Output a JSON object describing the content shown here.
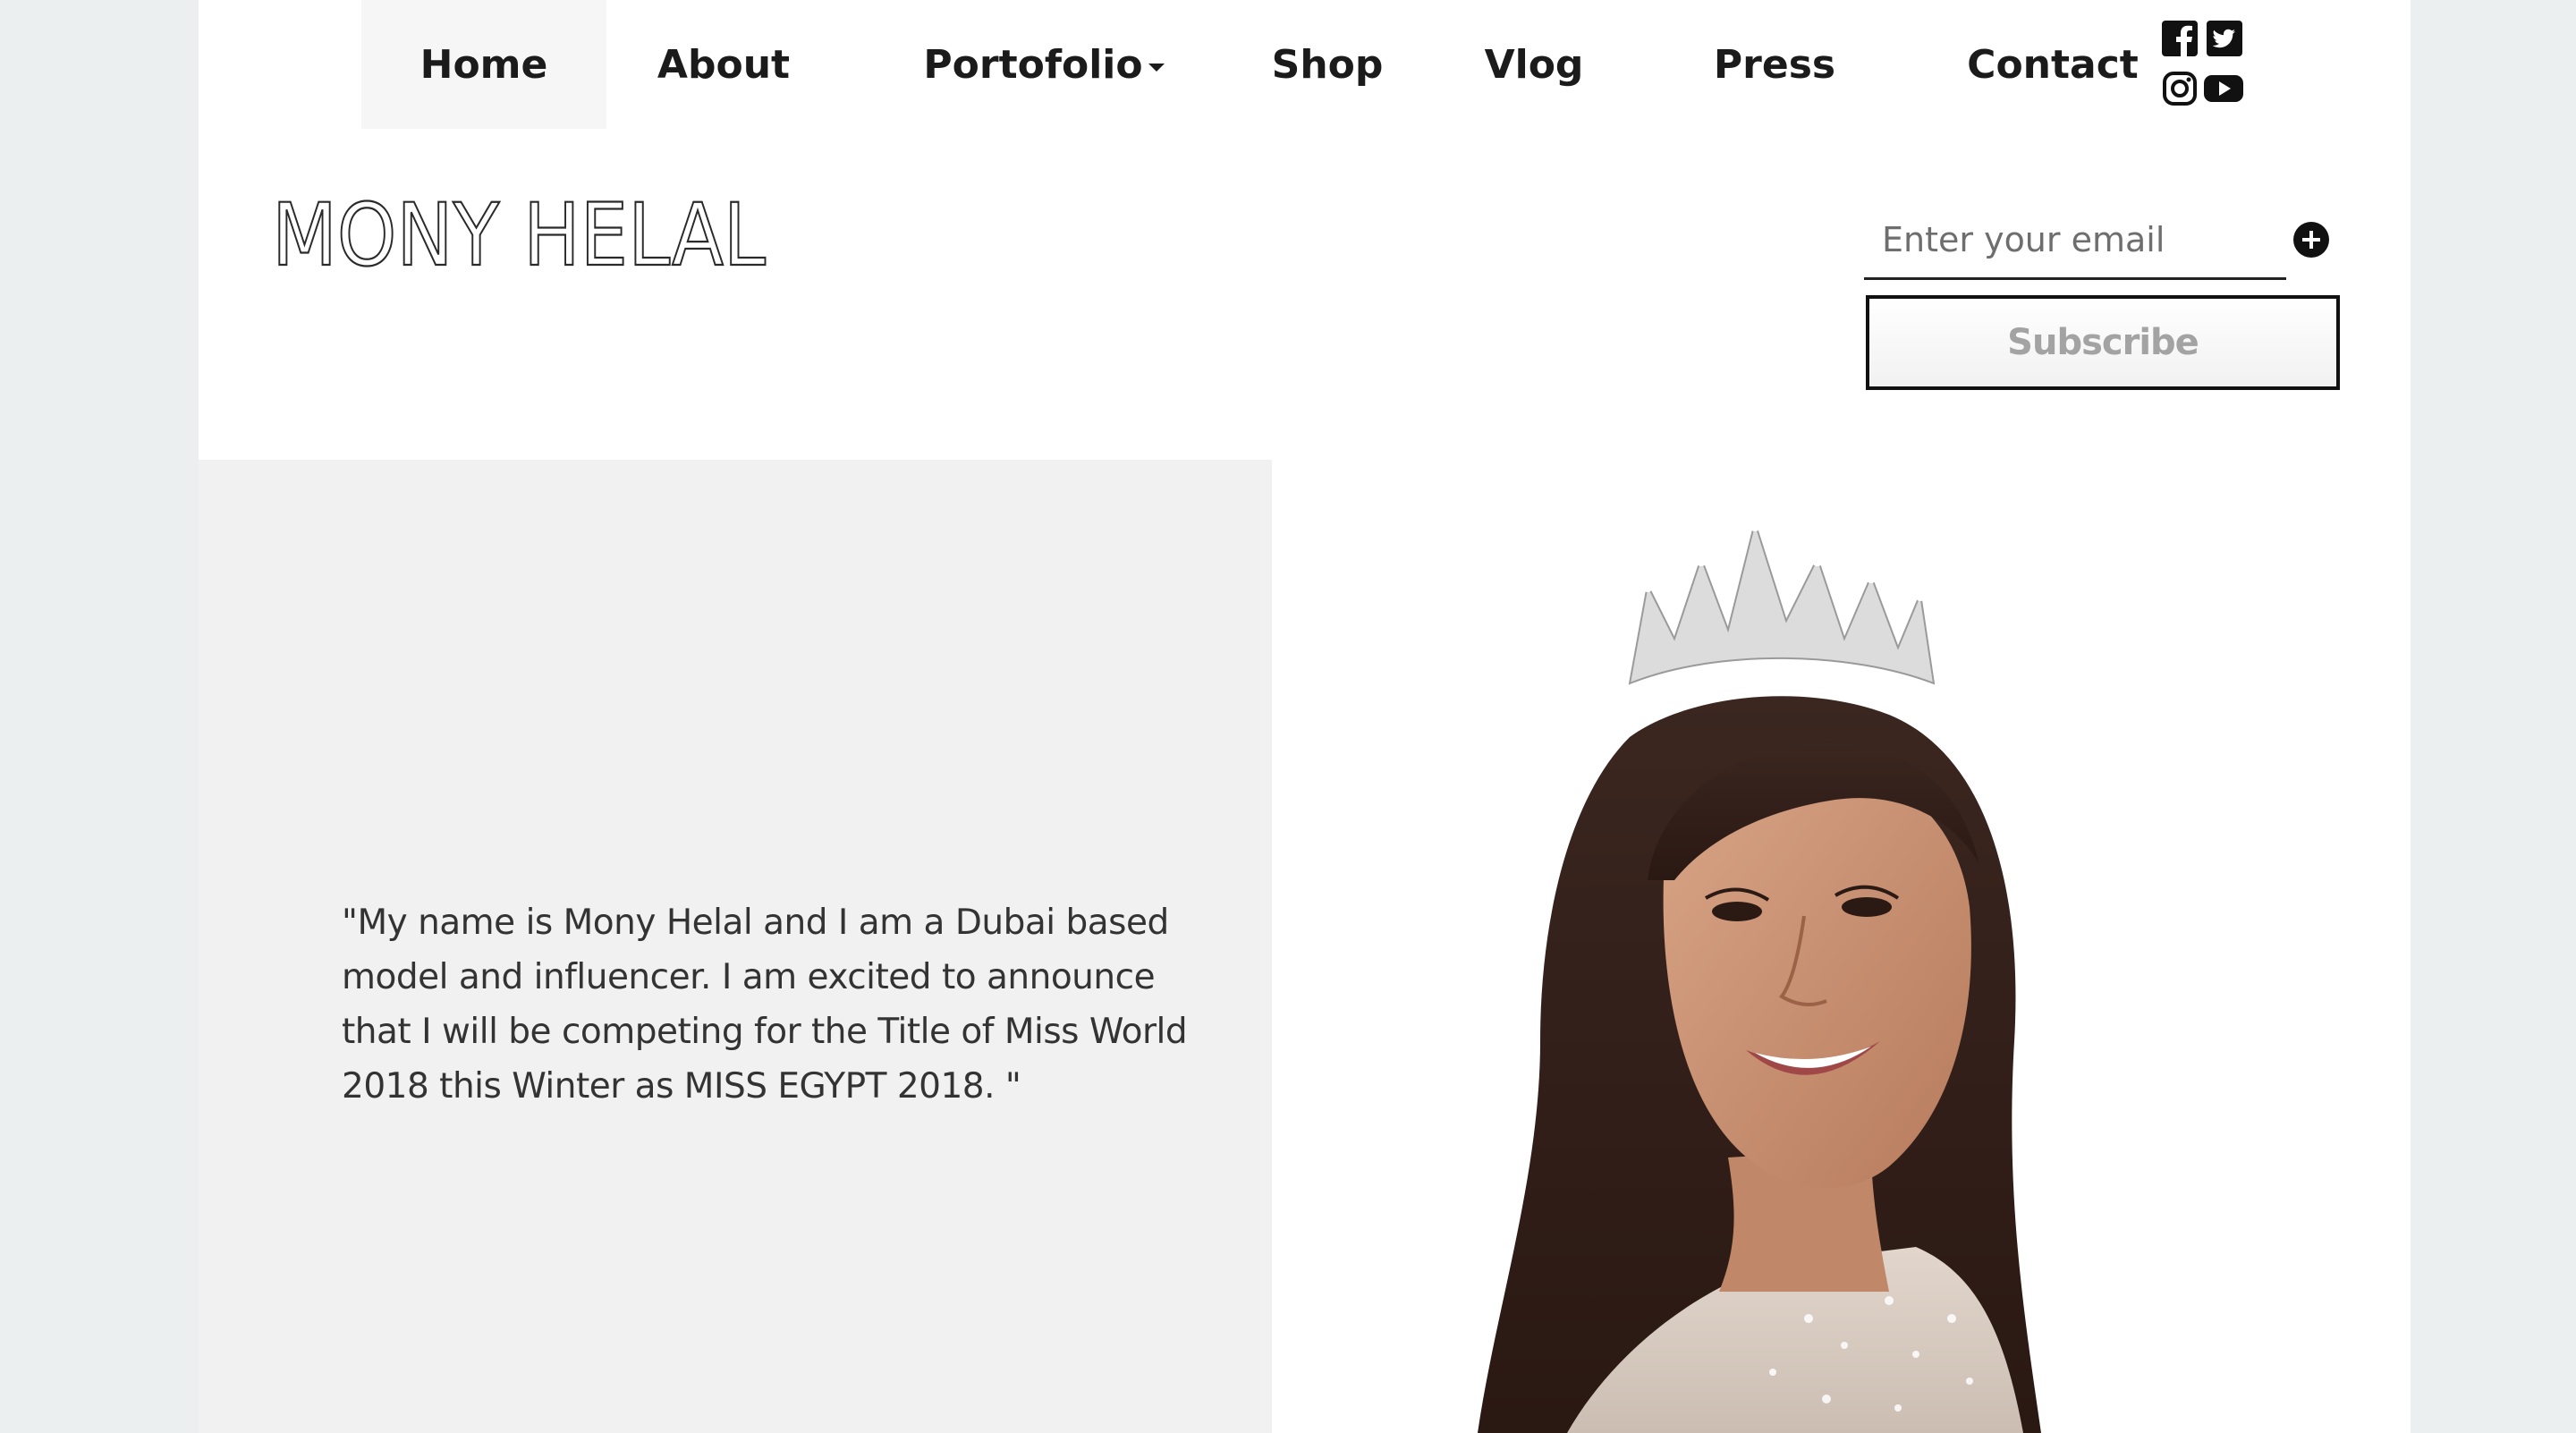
{
  "nav": {
    "items": [
      {
        "label": "Home",
        "active": true
      },
      {
        "label": "About"
      },
      {
        "label": "Portofolio",
        "has_dropdown": true
      },
      {
        "label": "Shop"
      },
      {
        "label": "Vlog"
      },
      {
        "label": "Press"
      },
      {
        "label": "Contact"
      }
    ],
    "social": [
      "facebook-icon",
      "twitter-icon",
      "instagram-icon",
      "youtube-icon"
    ]
  },
  "logo": {
    "text": "MONY HELAL"
  },
  "subscribe": {
    "email_placeholder": "Enter your email",
    "button_label": "Subscribe"
  },
  "hero": {
    "quote": "\"My name is Mony Helal and I am a Dubai based model and influencer. I am excited to announce that I will be competing for the Title of Miss World 2018 this Winter as MISS EGYPT 2018. \""
  },
  "colors": {
    "background": "#eceff0",
    "panel": "#f1f1f1",
    "text": "#1b1b1b"
  }
}
